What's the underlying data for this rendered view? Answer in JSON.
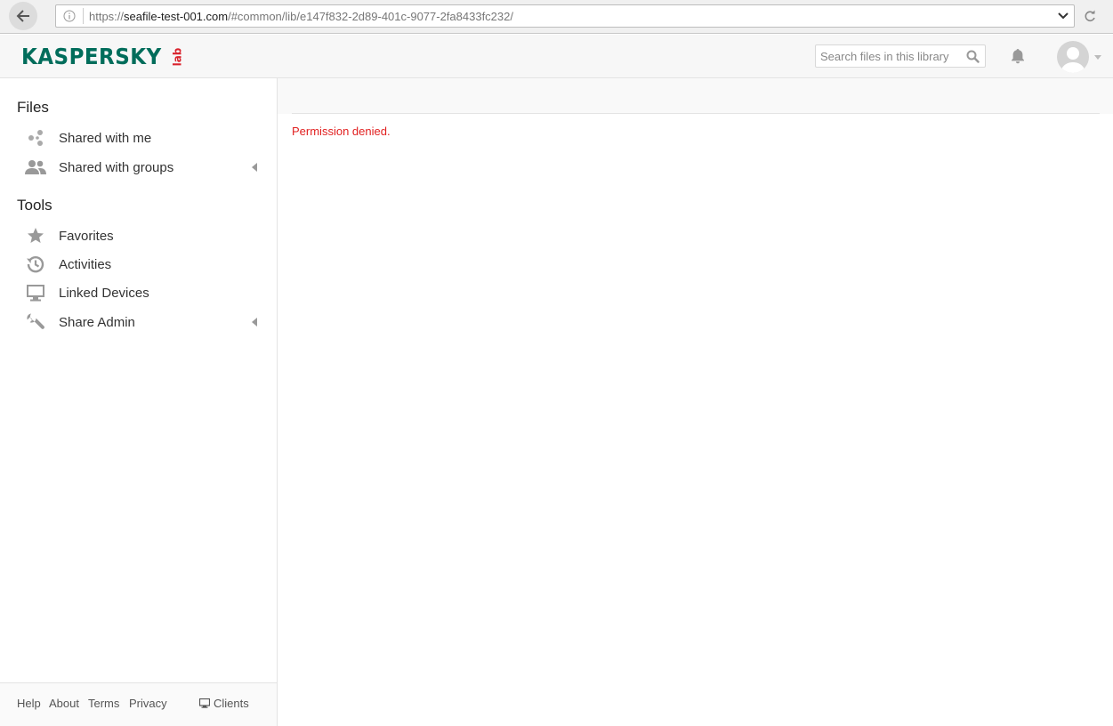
{
  "browser": {
    "url_scheme": "https://",
    "url_host": "seafile-test-001.com",
    "url_path": "/#common/lib/e147f832-2d89-401c-9077-2fa8433fc232/"
  },
  "header": {
    "logo_text": "KASPERSKY",
    "logo_sub": "lab",
    "search_placeholder": "Search files in this library"
  },
  "sidebar": {
    "files_heading": "Files",
    "files_items": [
      {
        "label": "Shared with me",
        "icon": "share-icon"
      },
      {
        "label": "Shared with groups",
        "icon": "group-icon"
      }
    ],
    "tools_heading": "Tools",
    "tools_items": [
      {
        "label": "Favorites",
        "icon": "star-icon"
      },
      {
        "label": "Activities",
        "icon": "history-icon"
      },
      {
        "label": "Linked Devices",
        "icon": "monitor-icon"
      },
      {
        "label": "Share Admin",
        "icon": "wrench-icon"
      }
    ],
    "footer": {
      "help": "Help",
      "about": "About",
      "terms": "Terms",
      "privacy": "Privacy",
      "clients": "Clients"
    }
  },
  "main": {
    "error": "Permission denied."
  },
  "colors": {
    "logo_green": "#006d5b",
    "logo_red": "#d9232d",
    "error_red": "#e12020",
    "icon_gray": "#999999"
  }
}
